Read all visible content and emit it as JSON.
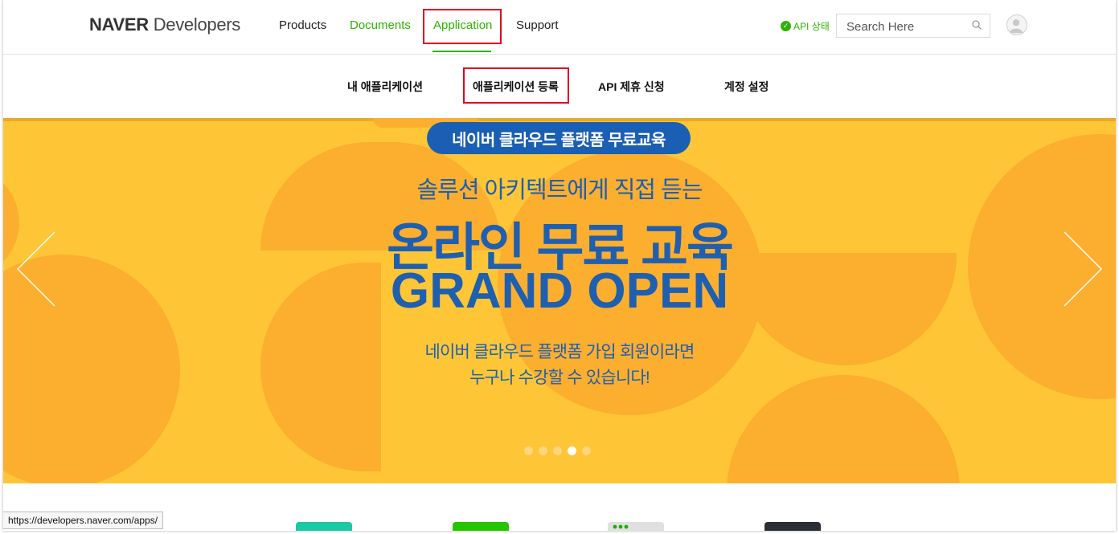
{
  "header": {
    "logo_bold": "NAVER",
    "logo_light": " Developers",
    "menu": {
      "products": "Products",
      "documents": "Documents",
      "application": "Application",
      "support": "Support"
    },
    "api_status": "API 상태",
    "search_placeholder": "Search Here"
  },
  "subnav": {
    "my_apps": "내 애플리케이션",
    "register_app": "애플리케이션 등록",
    "api_partnership": "API 제휴 신청",
    "account_settings": "계정 설정"
  },
  "banner": {
    "pill": "네이버 클라우드 플랫폼 무료교육",
    "line1": "솔루션 아키텍트에게 직접 듣는",
    "line2": "온라인 무료 교육",
    "line3": "GRAND OPEN",
    "line4a": "네이버 클라우드 플랫폼 가입 회원이라면",
    "line4b": "누구나 수강할 수 있습니다!",
    "slide_count": 5,
    "active_slide": 4
  },
  "status_url": "https://developers.naver.com/apps/",
  "colors": {
    "brand_green": "#2db400",
    "highlight_red": "#e1001b",
    "banner_yellow": "#fec636",
    "banner_blue": "#1f5fb0"
  }
}
